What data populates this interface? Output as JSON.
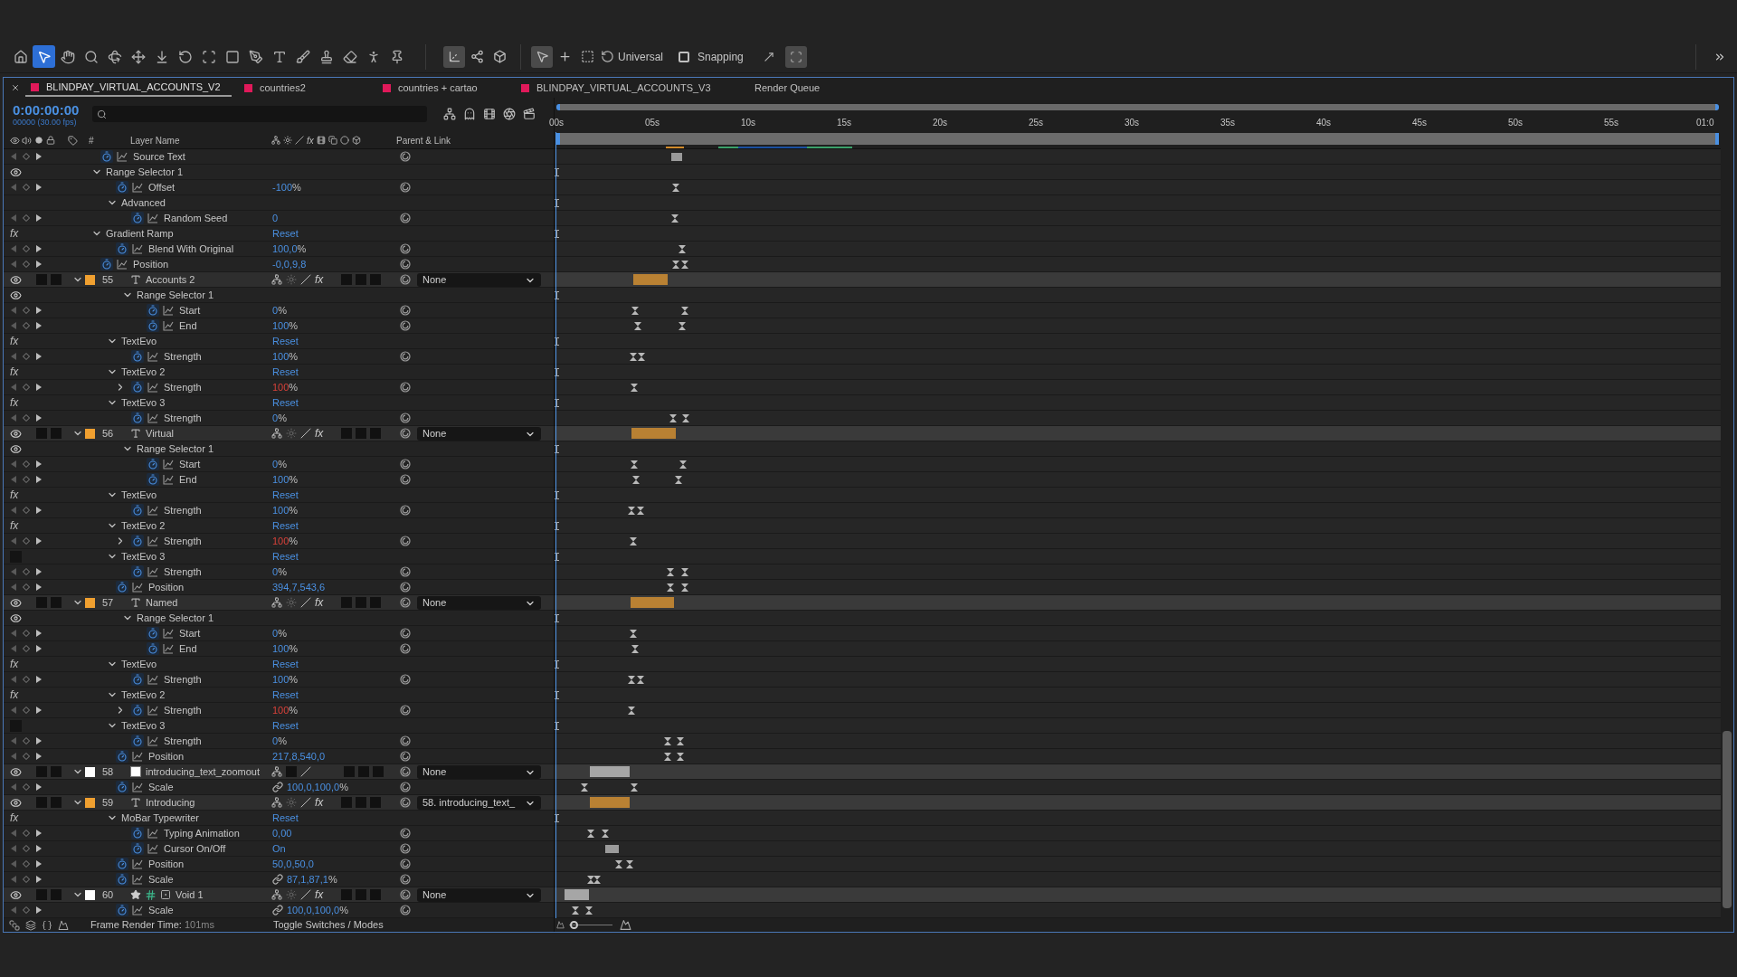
{
  "toolbar": {
    "tools": [
      {
        "selected": false
      },
      {
        "selected": true
      },
      {
        "selected": false
      },
      {
        "selected": false
      },
      {
        "selected": false
      },
      {
        "selected": false
      },
      {
        "selected": false
      },
      {
        "selected": false
      },
      {
        "selected": false
      },
      {
        "selected": false
      },
      {
        "selected": false
      },
      {
        "selected": false
      },
      {
        "selected": false
      },
      {
        "selected": false
      },
      {
        "selected": false
      },
      {
        "selected": false
      },
      {
        "selected": false
      }
    ],
    "axis_modes": [
      {
        "selected": true
      },
      {
        "selected": false
      },
      {
        "selected": false
      }
    ],
    "transform_tools": [
      {
        "selected": true
      },
      {
        "selected": false
      },
      {
        "selected": false
      }
    ],
    "coordinate_mode": "Universal",
    "snapping": {
      "label": "Snapping",
      "checked": false
    }
  },
  "tabs": [
    {
      "label": "BLINDPAY_VIRTUAL_ACCOUNTS_V2",
      "selected": true,
      "color": "#e0195a"
    },
    {
      "label": "countries2",
      "selected": false,
      "color": "#e0195a"
    },
    {
      "label": "countries + cartao",
      "selected": false,
      "color": "#e0195a"
    },
    {
      "label": "BLINDPAY_VIRTUAL_ACCOUNTS_V3",
      "selected": false,
      "color": "#e0195a"
    },
    {
      "label": "Render Queue",
      "selected": false
    }
  ],
  "timecode": "0:00:00:00",
  "frame_info": "00000 (30.00 fps)",
  "columns": {
    "fx": "fx",
    "number": "#",
    "layer_name": "Layer Name",
    "parent": "Parent & Link"
  },
  "ruler": [
    "00s",
    "05s",
    "10s",
    "15s",
    "20s",
    "25s",
    "30s",
    "35s",
    "40s",
    "45s",
    "50s",
    "55s",
    "01:0"
  ],
  "rows": [
    {
      "kind": "property",
      "name": "Source Text"
    },
    {
      "kind": "selector",
      "name": "Range Selector 1",
      "expanded": true,
      "children": [
        {
          "kind": "property",
          "name": "Offset",
          "value": "-100",
          "unit": "%"
        },
        {
          "kind": "group",
          "name": "Advanced",
          "expanded": true,
          "children": [
            {
              "kind": "property",
              "name": "Random Seed",
              "value": "0"
            }
          ]
        }
      ]
    },
    {
      "kind": "effect",
      "name": "Gradient Ramp",
      "badge": "fx",
      "enabled": true,
      "reset": "Reset",
      "expanded": true,
      "children": [
        {
          "kind": "property",
          "name": "Blend With Original",
          "value": "100,0",
          "unit": "%"
        }
      ]
    },
    {
      "kind": "property",
      "name": "Position",
      "value": "-0,0,9,8"
    },
    {
      "kind": "text_layer",
      "number": "55",
      "name": "Accounts 2",
      "color": "#f0a030",
      "solo": false,
      "locked": false,
      "fx": "fx",
      "effects_on": true,
      "parent": "None",
      "expanded": true,
      "children": [
        {
          "kind": "selector",
          "name": "Range Selector 1",
          "expanded": true,
          "children": [
            {
              "kind": "property",
              "name": "Start",
              "value": "0",
              "unit": "%"
            },
            {
              "kind": "property",
              "name": "End",
              "value": "100",
              "unit": "%"
            }
          ]
        },
        {
          "kind": "effect",
          "name": "TextEvo",
          "badge": "fx",
          "enabled": true,
          "reset": "Reset",
          "expanded": true,
          "children": [
            {
              "kind": "property",
              "name": "Strength",
              "value": "100",
              "unit": "%"
            }
          ]
        },
        {
          "kind": "effect",
          "name": "TextEvo 2",
          "badge": "fx",
          "enabled": true,
          "reset": "Reset",
          "expanded": true,
          "children": [
            {
              "kind": "property",
              "name": "Strength",
              "value": "100",
              "unit": "%",
              "expression": true
            }
          ]
        },
        {
          "kind": "effect",
          "name": "TextEvo 3",
          "badge": "fx",
          "enabled": true,
          "reset": "Reset",
          "expanded": true,
          "children": [
            {
              "kind": "property",
              "name": "Strength",
              "value": "0",
              "unit": "%"
            }
          ]
        }
      ]
    },
    {
      "kind": "text_layer",
      "number": "56",
      "name": "Virtual",
      "color": "#f0a030",
      "solo": false,
      "locked": false,
      "fx": "fx",
      "effects_on": true,
      "parent": "None",
      "expanded": true,
      "children": [
        {
          "kind": "selector",
          "name": "Range Selector 1",
          "expanded": true,
          "children": [
            {
              "kind": "property",
              "name": "Start",
              "value": "0",
              "unit": "%"
            },
            {
              "kind": "property",
              "name": "End",
              "value": "100",
              "unit": "%"
            }
          ]
        },
        {
          "kind": "effect",
          "name": "TextEvo",
          "badge": "fx",
          "enabled": true,
          "reset": "Reset",
          "expanded": true,
          "children": [
            {
              "kind": "property",
              "name": "Strength",
              "value": "100",
              "unit": "%"
            }
          ]
        },
        {
          "kind": "effect",
          "name": "TextEvo 2",
          "badge": "fx",
          "enabled": true,
          "reset": "Reset",
          "expanded": true,
          "children": [
            {
              "kind": "property",
              "name": "Strength",
              "value": "100",
              "unit": "%",
              "expression": true
            }
          ]
        },
        {
          "kind": "effect",
          "name": "TextEvo 3",
          "enabled": false,
          "reset": "Reset",
          "expanded": true,
          "children": [
            {
              "kind": "property",
              "name": "Strength",
              "value": "0",
              "unit": "%"
            }
          ]
        },
        {
          "kind": "property",
          "name": "Position",
          "value": "394,7,543,6"
        }
      ]
    },
    {
      "kind": "text_layer",
      "number": "57",
      "name": "Named",
      "color": "#f0a030",
      "solo": false,
      "locked": false,
      "fx": "fx",
      "effects_on": true,
      "parent": "None",
      "expanded": true,
      "children": [
        {
          "kind": "selector",
          "name": "Range Selector 1",
          "expanded": true,
          "children": [
            {
              "kind": "property",
              "name": "Start",
              "value": "0",
              "unit": "%"
            },
            {
              "kind": "property",
              "name": "End",
              "value": "100",
              "unit": "%"
            }
          ]
        },
        {
          "kind": "effect",
          "name": "TextEvo",
          "badge": "fx",
          "enabled": true,
          "reset": "Reset",
          "expanded": true,
          "children": [
            {
              "kind": "property",
              "name": "Strength",
              "value": "100",
              "unit": "%"
            }
          ]
        },
        {
          "kind": "effect",
          "name": "TextEvo 2",
          "badge": "fx",
          "enabled": true,
          "reset": "Reset",
          "expanded": true,
          "children": [
            {
              "kind": "property",
              "name": "Strength",
              "value": "100",
              "unit": "%",
              "expression": true
            }
          ]
        },
        {
          "kind": "effect",
          "name": "TextEvo 3",
          "enabled": false,
          "reset": "Reset",
          "expanded": true,
          "children": [
            {
              "kind": "property",
              "name": "Strength",
              "value": "0",
              "unit": "%"
            }
          ]
        },
        {
          "kind": "property",
          "name": "Position",
          "value": "217,8,540,0"
        }
      ]
    },
    {
      "kind": "solid_layer",
      "number": "58",
      "name": "introducing_text_zoomout",
      "color": "#ffffff",
      "solo": false,
      "locked": false,
      "parent": "None",
      "expanded": true,
      "children": [
        {
          "kind": "property",
          "name": "Scale",
          "value": "100,0,100,0",
          "unit": "%",
          "linked": true
        }
      ]
    },
    {
      "kind": "text_layer",
      "number": "59",
      "name": "Introducing",
      "color": "#f0a030",
      "solo": false,
      "locked": false,
      "fx": "fx",
      "effects_on": true,
      "parent": "58. introducing_text_",
      "expanded": true,
      "children": [
        {
          "kind": "effect",
          "name": "MoBar Typewriter",
          "badge": "fx",
          "enabled": true,
          "reset": "Reset",
          "expanded": true,
          "children": [
            {
              "kind": "property",
              "name": "Typing Animation",
              "value": "0,00"
            },
            {
              "kind": "property",
              "name": "Cursor On/Off",
              "value": "On"
            }
          ]
        },
        {
          "kind": "property",
          "name": "Position",
          "value": "50,0,50,0"
        },
        {
          "kind": "property",
          "name": "Scale",
          "value": "87,1,87,1",
          "unit": "%",
          "linked": true
        }
      ]
    },
    {
      "kind": "null_layer",
      "number": "60",
      "name": "Void 1",
      "color": "#ffffff",
      "solo": false,
      "locked": false,
      "fx": "fx",
      "effects_on": true,
      "parent": "None",
      "expanded": true,
      "children": [
        {
          "kind": "property",
          "name": "Scale",
          "value": "100,0,100,0",
          "unit": "%",
          "linked": true
        }
      ]
    }
  ],
  "footer": {
    "render_time_label": "Frame Render Time:",
    "render_time": "101ms",
    "toggle": "Toggle Switches / Modes"
  },
  "zoom": {
    "level": 0.1
  }
}
